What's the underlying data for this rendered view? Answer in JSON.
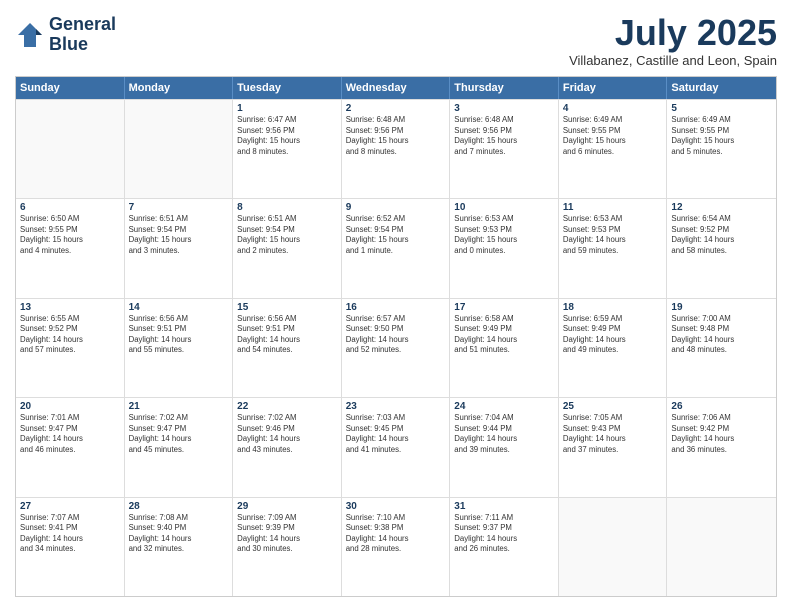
{
  "logo": {
    "line1": "General",
    "line2": "Blue"
  },
  "title": "July 2025",
  "location": "Villabanez, Castille and Leon, Spain",
  "weekdays": [
    "Sunday",
    "Monday",
    "Tuesday",
    "Wednesday",
    "Thursday",
    "Friday",
    "Saturday"
  ],
  "rows": [
    [
      {
        "day": "",
        "info": ""
      },
      {
        "day": "",
        "info": ""
      },
      {
        "day": "1",
        "info": "Sunrise: 6:47 AM\nSunset: 9:56 PM\nDaylight: 15 hours\nand 8 minutes."
      },
      {
        "day": "2",
        "info": "Sunrise: 6:48 AM\nSunset: 9:56 PM\nDaylight: 15 hours\nand 8 minutes."
      },
      {
        "day": "3",
        "info": "Sunrise: 6:48 AM\nSunset: 9:56 PM\nDaylight: 15 hours\nand 7 minutes."
      },
      {
        "day": "4",
        "info": "Sunrise: 6:49 AM\nSunset: 9:55 PM\nDaylight: 15 hours\nand 6 minutes."
      },
      {
        "day": "5",
        "info": "Sunrise: 6:49 AM\nSunset: 9:55 PM\nDaylight: 15 hours\nand 5 minutes."
      }
    ],
    [
      {
        "day": "6",
        "info": "Sunrise: 6:50 AM\nSunset: 9:55 PM\nDaylight: 15 hours\nand 4 minutes."
      },
      {
        "day": "7",
        "info": "Sunrise: 6:51 AM\nSunset: 9:54 PM\nDaylight: 15 hours\nand 3 minutes."
      },
      {
        "day": "8",
        "info": "Sunrise: 6:51 AM\nSunset: 9:54 PM\nDaylight: 15 hours\nand 2 minutes."
      },
      {
        "day": "9",
        "info": "Sunrise: 6:52 AM\nSunset: 9:54 PM\nDaylight: 15 hours\nand 1 minute."
      },
      {
        "day": "10",
        "info": "Sunrise: 6:53 AM\nSunset: 9:53 PM\nDaylight: 15 hours\nand 0 minutes."
      },
      {
        "day": "11",
        "info": "Sunrise: 6:53 AM\nSunset: 9:53 PM\nDaylight: 14 hours\nand 59 minutes."
      },
      {
        "day": "12",
        "info": "Sunrise: 6:54 AM\nSunset: 9:52 PM\nDaylight: 14 hours\nand 58 minutes."
      }
    ],
    [
      {
        "day": "13",
        "info": "Sunrise: 6:55 AM\nSunset: 9:52 PM\nDaylight: 14 hours\nand 57 minutes."
      },
      {
        "day": "14",
        "info": "Sunrise: 6:56 AM\nSunset: 9:51 PM\nDaylight: 14 hours\nand 55 minutes."
      },
      {
        "day": "15",
        "info": "Sunrise: 6:56 AM\nSunset: 9:51 PM\nDaylight: 14 hours\nand 54 minutes."
      },
      {
        "day": "16",
        "info": "Sunrise: 6:57 AM\nSunset: 9:50 PM\nDaylight: 14 hours\nand 52 minutes."
      },
      {
        "day": "17",
        "info": "Sunrise: 6:58 AM\nSunset: 9:49 PM\nDaylight: 14 hours\nand 51 minutes."
      },
      {
        "day": "18",
        "info": "Sunrise: 6:59 AM\nSunset: 9:49 PM\nDaylight: 14 hours\nand 49 minutes."
      },
      {
        "day": "19",
        "info": "Sunrise: 7:00 AM\nSunset: 9:48 PM\nDaylight: 14 hours\nand 48 minutes."
      }
    ],
    [
      {
        "day": "20",
        "info": "Sunrise: 7:01 AM\nSunset: 9:47 PM\nDaylight: 14 hours\nand 46 minutes."
      },
      {
        "day": "21",
        "info": "Sunrise: 7:02 AM\nSunset: 9:47 PM\nDaylight: 14 hours\nand 45 minutes."
      },
      {
        "day": "22",
        "info": "Sunrise: 7:02 AM\nSunset: 9:46 PM\nDaylight: 14 hours\nand 43 minutes."
      },
      {
        "day": "23",
        "info": "Sunrise: 7:03 AM\nSunset: 9:45 PM\nDaylight: 14 hours\nand 41 minutes."
      },
      {
        "day": "24",
        "info": "Sunrise: 7:04 AM\nSunset: 9:44 PM\nDaylight: 14 hours\nand 39 minutes."
      },
      {
        "day": "25",
        "info": "Sunrise: 7:05 AM\nSunset: 9:43 PM\nDaylight: 14 hours\nand 37 minutes."
      },
      {
        "day": "26",
        "info": "Sunrise: 7:06 AM\nSunset: 9:42 PM\nDaylight: 14 hours\nand 36 minutes."
      }
    ],
    [
      {
        "day": "27",
        "info": "Sunrise: 7:07 AM\nSunset: 9:41 PM\nDaylight: 14 hours\nand 34 minutes."
      },
      {
        "day": "28",
        "info": "Sunrise: 7:08 AM\nSunset: 9:40 PM\nDaylight: 14 hours\nand 32 minutes."
      },
      {
        "day": "29",
        "info": "Sunrise: 7:09 AM\nSunset: 9:39 PM\nDaylight: 14 hours\nand 30 minutes."
      },
      {
        "day": "30",
        "info": "Sunrise: 7:10 AM\nSunset: 9:38 PM\nDaylight: 14 hours\nand 28 minutes."
      },
      {
        "day": "31",
        "info": "Sunrise: 7:11 AM\nSunset: 9:37 PM\nDaylight: 14 hours\nand 26 minutes."
      },
      {
        "day": "",
        "info": ""
      },
      {
        "day": "",
        "info": ""
      }
    ]
  ]
}
